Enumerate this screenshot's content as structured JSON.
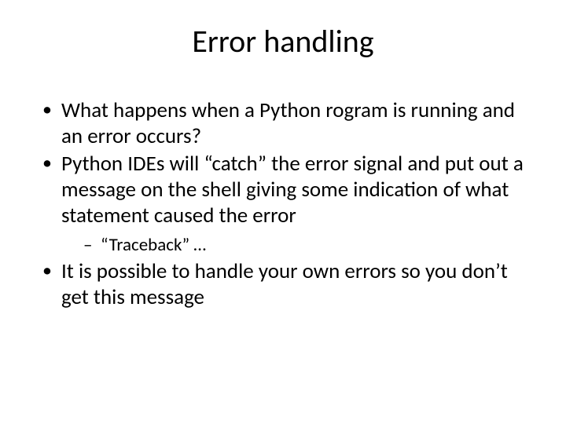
{
  "slide": {
    "title": "Error handling",
    "bullets": [
      {
        "text": "What happens when a Python rogram is running and an error occurs?"
      },
      {
        "text": "Python IDEs will “catch” the error signal and put out a message on the shell giving some indication of what statement caused the error",
        "sub": [
          "“Traceback” …"
        ]
      },
      {
        "text": "It is possible to handle your own errors so you don’t get this message"
      }
    ]
  }
}
